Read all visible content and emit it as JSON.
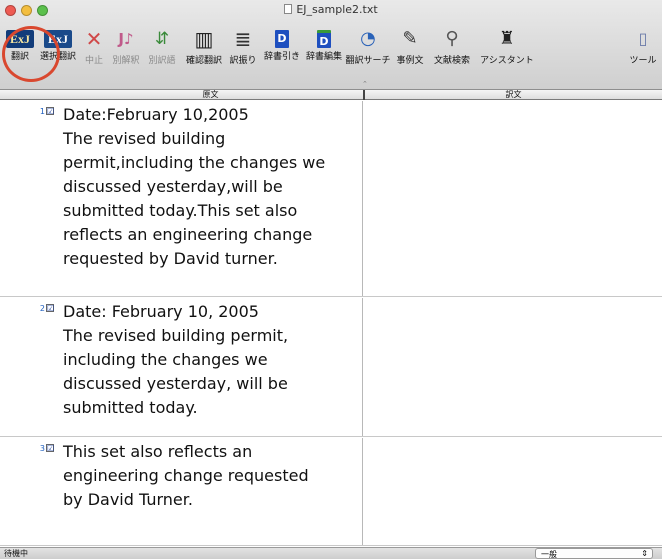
{
  "window": {
    "title": "EJ_sample2.txt",
    "traffic_colors": [
      "#ee5b53",
      "#f3be3f",
      "#5bc04c"
    ]
  },
  "toolbar": {
    "items": [
      {
        "label": "翻訳",
        "icon": "exj-translate-icon",
        "glyph": "ExJ",
        "enabled": true
      },
      {
        "label": "選択翻訳",
        "icon": "exj-select-translate-icon",
        "glyph": "ExJ",
        "enabled": true
      },
      {
        "label": "中止",
        "icon": "stop-x-icon",
        "glyph": "✕",
        "enabled": false
      },
      {
        "label": "別解釈",
        "icon": "alt-interpretation-icon",
        "glyph": "J♪",
        "enabled": false
      },
      {
        "label": "別訳語",
        "icon": "alt-term-icon",
        "glyph": "⇵",
        "enabled": false
      },
      {
        "label": "確認翻訳",
        "icon": "columns-icon",
        "glyph": "▥",
        "enabled": true
      },
      {
        "label": "訳振り",
        "icon": "lines-icon",
        "glyph": "≣",
        "enabled": true
      },
      {
        "label": "辞書引き",
        "icon": "dictionary-icon",
        "glyph": "D",
        "enabled": true
      },
      {
        "label": "辞書編集",
        "icon": "dictionary-edit-icon",
        "glyph": "D",
        "enabled": true
      },
      {
        "label": "翻訳サーチ",
        "icon": "translation-search-icon",
        "glyph": "🔍",
        "enabled": true
      },
      {
        "label": "事例文",
        "icon": "example-book-icon",
        "glyph": "📖",
        "enabled": true
      },
      {
        "label": "文献検索",
        "icon": "magnifier-icon",
        "glyph": "🔎",
        "enabled": true
      },
      {
        "label": "アシスタント",
        "icon": "assistant-icon",
        "glyph": "👔",
        "enabled": true
      },
      {
        "label": "ツール",
        "icon": "tool-panel-icon",
        "glyph": "▯",
        "enabled": true
      }
    ]
  },
  "columns": {
    "source": "原文",
    "target": "訳文"
  },
  "segments": [
    {
      "number": "1",
      "checked": "☑",
      "lines": [
        "Date:February 10,2005",
        "The revised building",
        "permit,including the changes we",
        "discussed yesterday,will be",
        "submitted today.This set also",
        "reflects an engineering change",
        "requested by David turner."
      ],
      "translation": ""
    },
    {
      "number": "2",
      "checked": "☑",
      "lines": [
        "Date: February 10, 2005",
        "The revised building permit,",
        "including the changes we",
        "discussed yesterday, will be",
        "submitted today."
      ],
      "translation": ""
    },
    {
      "number": "3",
      "checked": "☑",
      "lines": [
        "This set also reflects an",
        "engineering change requested",
        "by David Turner."
      ],
      "translation": ""
    }
  ],
  "status": {
    "text": "待機中",
    "mode": "一般",
    "mode_arrows": "⇕"
  }
}
